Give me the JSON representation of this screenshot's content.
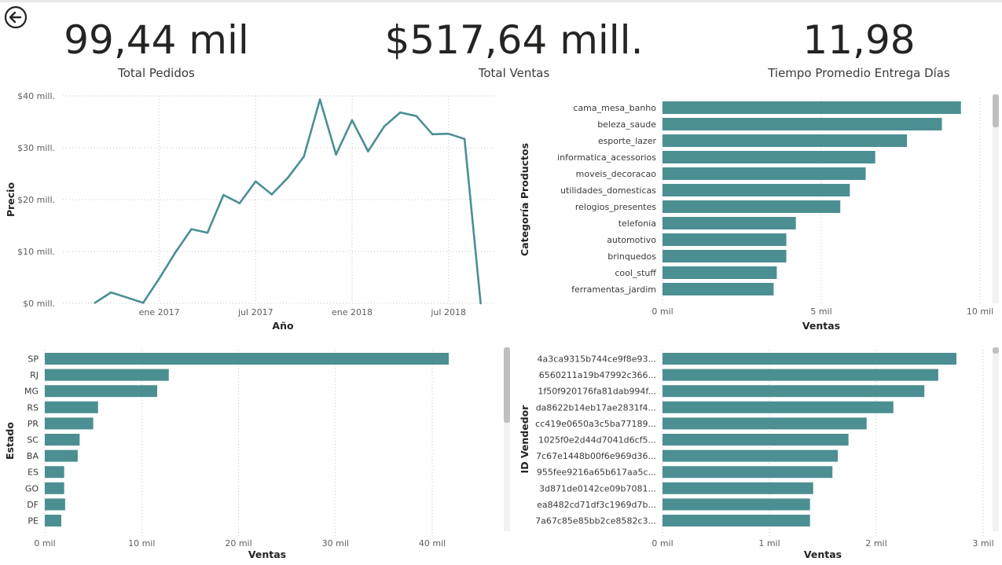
{
  "kpis": [
    {
      "value": "99,44 mil",
      "label": "Total Pedidos"
    },
    {
      "value": "$517,64 mill.",
      "label": "Total Ventas"
    },
    {
      "value": "11,98",
      "label": "Tiempo Promedio Entrega Días"
    }
  ],
  "icons": {
    "back": "back-arrow-icon"
  },
  "colors": {
    "bar": "#4b8f92",
    "line": "#4b8f92"
  },
  "chart_data": [
    {
      "type": "line",
      "xlabel": "Año",
      "ylabel": "Precio",
      "ylim": [
        0,
        40
      ],
      "yticks": [
        "$0 mill.",
        "$10 mill.",
        "$20 mill.",
        "$30 mill.",
        "$40 mill."
      ],
      "xticks": [
        "ene 2017",
        "jul 2017",
        "ene 2018",
        "jul 2018"
      ],
      "grid": true,
      "x": [
        "2016-09",
        "2016-10",
        "2016-11",
        "2016-12",
        "2017-01",
        "2017-02",
        "2017-03",
        "2017-04",
        "2017-05",
        "2017-06",
        "2017-07",
        "2017-08",
        "2017-09",
        "2017-10",
        "2017-11",
        "2017-12",
        "2018-01",
        "2018-02",
        "2018-03",
        "2018-04",
        "2018-05",
        "2018-06",
        "2018-07",
        "2018-08",
        "2018-09"
      ],
      "y": [
        0.1,
        2.1,
        1.1,
        0.1,
        4.8,
        9.8,
        14.3,
        13.6,
        20.9,
        19.3,
        23.5,
        21.0,
        24.2,
        28.3,
        39.3,
        28.7,
        35.3,
        29.3,
        34.1,
        36.8,
        36.1,
        32.6,
        32.7,
        31.7,
        0.0
      ]
    },
    {
      "type": "bar",
      "orientation": "horizontal",
      "ylabel": "Categoría Productos",
      "xlabel": "Ventas",
      "xlim": [
        0,
        10
      ],
      "xticks": [
        "0 mil",
        "5 mil",
        "10 mil"
      ],
      "categories": [
        "cama_mesa_banho",
        "beleza_saude",
        "esporte_lazer",
        "informatica_acessorios",
        "moveis_decoracao",
        "utilidades_domesticas",
        "relogios_presentes",
        "telefonia",
        "automotivo",
        "brinquedos",
        "cool_stuff",
        "ferramentas_jardim"
      ],
      "values": [
        9.4,
        8.8,
        7.7,
        6.7,
        6.4,
        5.9,
        5.6,
        4.2,
        3.9,
        3.9,
        3.6,
        3.5
      ]
    },
    {
      "type": "bar",
      "orientation": "horizontal",
      "ylabel": "Estado",
      "xlabel": "Ventas",
      "xlim": [
        0,
        46
      ],
      "xticks": [
        "0 mil",
        "10 mil",
        "20 mil",
        "30 mil",
        "40 mil"
      ],
      "categories": [
        "SP",
        "RJ",
        "MG",
        "RS",
        "PR",
        "SC",
        "BA",
        "ES",
        "GO",
        "DF",
        "PE"
      ],
      "values": [
        41.7,
        12.8,
        11.6,
        5.5,
        5.0,
        3.6,
        3.4,
        2.0,
        2.0,
        2.1,
        1.7
      ]
    },
    {
      "type": "bar",
      "orientation": "horizontal",
      "ylabel": "ID Vendedor",
      "xlabel": "Ventas",
      "xlim": [
        0,
        3
      ],
      "xticks": [
        "0 mil",
        "1 mil",
        "2 mil",
        "3 mil"
      ],
      "categories": [
        "4a3ca9315b744ce9f8e93...",
        "6560211a19b47992c366...",
        "1f50f920176fa81dab994f...",
        "da8622b14eb17ae2831f4...",
        "cc419e0650a3c5ba77189...",
        "1025f0e2d44d7041d6cf5...",
        "7c67e1448b00f6e969d36...",
        "955fee9216a65b617aa5c...",
        "3d871de0142ce09b7081...",
        "ea8482cd71df3c1969d7b...",
        "7a67c85e85bb2ce8582c3..."
      ],
      "values": [
        2.75,
        2.58,
        2.45,
        2.16,
        1.91,
        1.74,
        1.64,
        1.59,
        1.41,
        1.38,
        1.38
      ]
    }
  ]
}
